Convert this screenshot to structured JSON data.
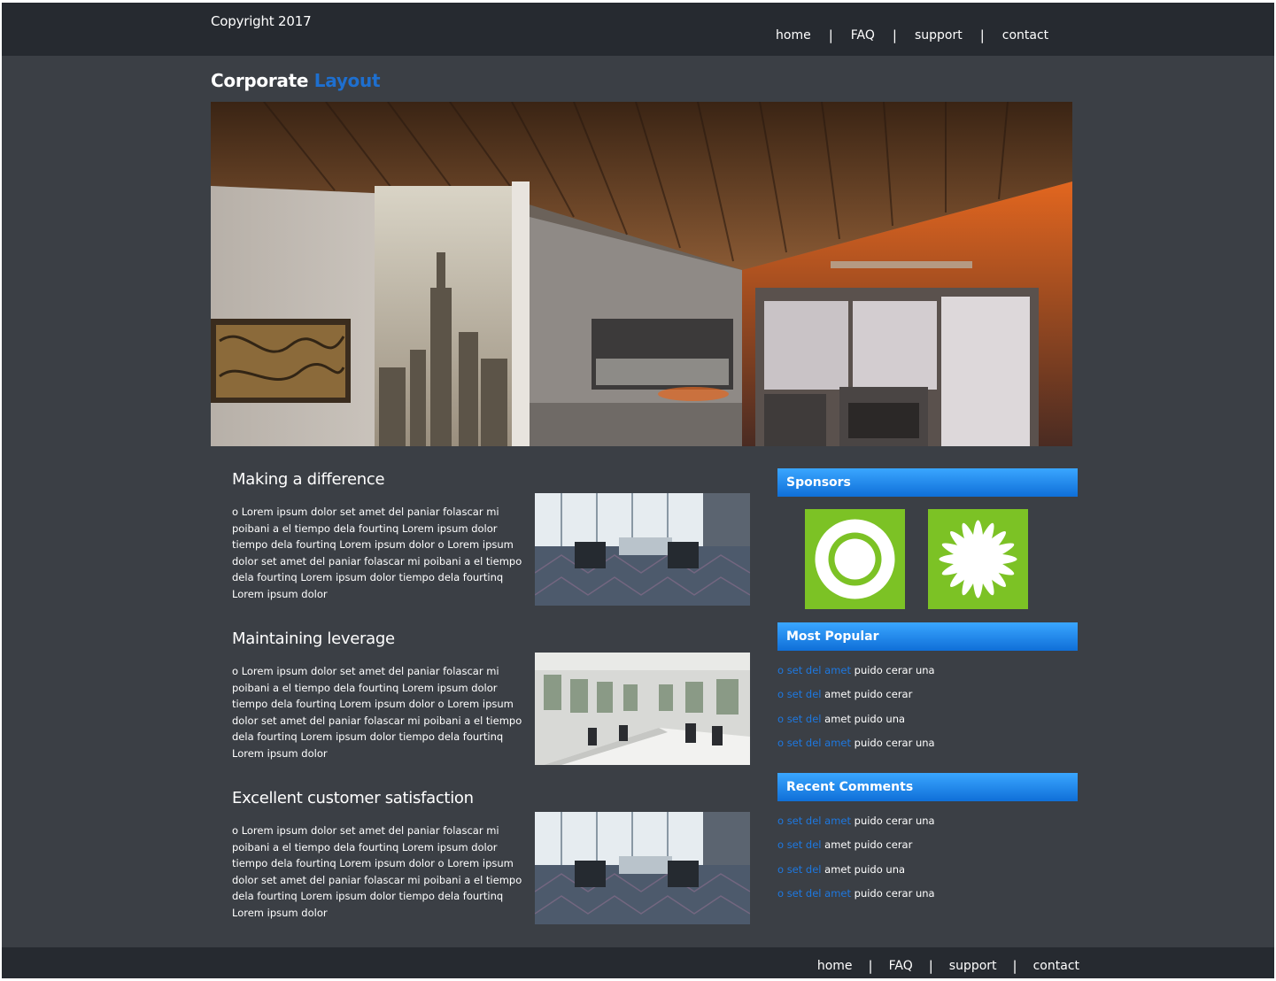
{
  "header": {
    "copyright": "Copyright 2017",
    "nav": [
      "home",
      "FAQ",
      "support",
      "contact"
    ],
    "separator": "|"
  },
  "brand": {
    "part1": "Corporate",
    "part2": "Layout"
  },
  "articles": [
    {
      "title": "Making a difference",
      "body": "o Lorem ipsum dolor set amet del paniar folascar mi poibani a el tiempo dela fourtinq Lorem ipsum dolor tiempo dela fourtinq Lorem ipsum dolor o Lorem ipsum dolor set amet del paniar folascar mi poibani a el tiempo dela fourtinq Lorem ipsum dolor tiempo dela fourtinq Lorem ipsum dolor"
    },
    {
      "title": "Maintaining leverage",
      "body": "o Lorem ipsum dolor set amet del paniar folascar mi poibani a el tiempo dela fourtinq Lorem ipsum dolor tiempo dela fourtinq Lorem ipsum dolor o Lorem ipsum dolor set amet del paniar folascar mi poibani a el tiempo dela fourtinq Lorem ipsum dolor tiempo dela fourtinq Lorem ipsum dolor"
    },
    {
      "title": "Excellent customer satisfaction",
      "body": "o Lorem ipsum dolor set amet del paniar folascar mi poibani a el tiempo dela fourtinq Lorem ipsum dolor tiempo dela fourtinq Lorem ipsum dolor o Lorem ipsum dolor set amet del paniar folascar mi poibani a el tiempo dela fourtinq Lorem ipsum dolor tiempo dela fourtinq Lorem ipsum dolor"
    }
  ],
  "sidebar": {
    "sponsors_title": "Sponsors",
    "popular_title": "Most Popular",
    "comments_title": "Recent Comments",
    "popular": [
      {
        "link": "o set del amet",
        "text": " puido cerar una"
      },
      {
        "link": "o set del",
        "text": " amet puido cerar"
      },
      {
        "link": "o set del",
        "text": " amet puido una"
      },
      {
        "link": "o set del amet",
        "text": " puido cerar una"
      }
    ],
    "comments": [
      {
        "link": "o set del amet",
        "text": " puido cerar una"
      },
      {
        "link": "o set del",
        "text": " amet puido cerar"
      },
      {
        "link": "o set del",
        "text": " amet puido una"
      },
      {
        "link": "o set del amet",
        "text": " puido cerar una"
      }
    ]
  },
  "footer": {
    "nav": [
      "home",
      "FAQ",
      "support",
      "contact"
    ]
  },
  "colors": {
    "background": "#3b3f45",
    "bar": "#262a30",
    "accent": "#1e6fcf",
    "sponsor_green": "#7cc225"
  }
}
